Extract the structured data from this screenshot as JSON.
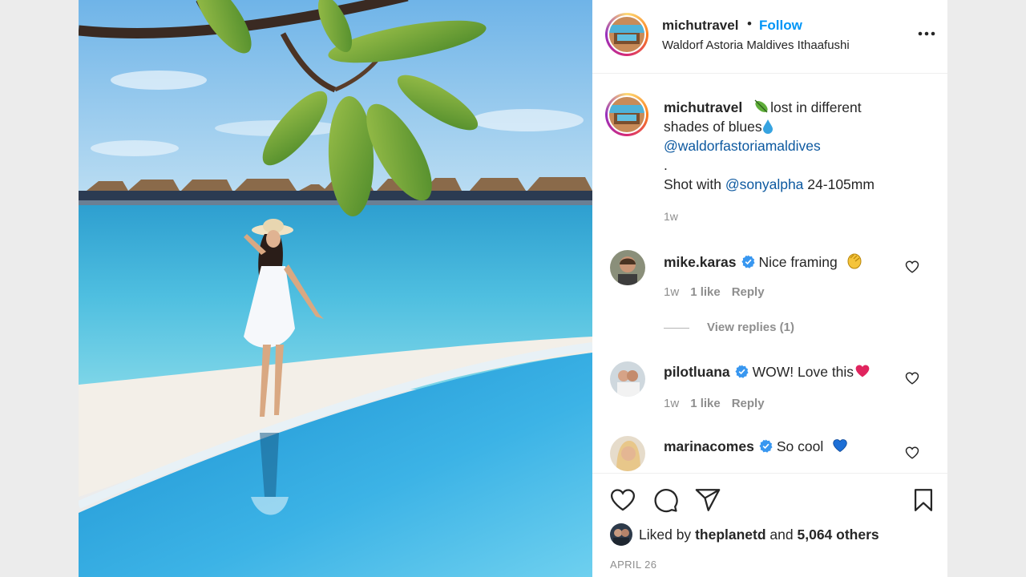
{
  "post": {
    "username": "michutravel",
    "separator": "•",
    "follow_label": "Follow",
    "location": "Waldorf Astoria Maldives Ithaafushi"
  },
  "caption": {
    "username": "michutravel",
    "text_1": "lost in different",
    "text_2": "shades of blues",
    "mention_1": "@waldorfastoriamaldives",
    "dot": ".",
    "shot_with": "Shot with",
    "mention_2": "@sonyalpha",
    "lens": "24-105mm",
    "time": "1w"
  },
  "comments": [
    {
      "username": "mike.karas",
      "text": "Nice framing",
      "time": "1w",
      "likes": "1 like",
      "reply": "Reply",
      "emoji": "clap-emoji"
    },
    {
      "username": "pilotluana",
      "text": "WOW! Love this",
      "time": "1w",
      "likes": "1 like",
      "reply": "Reply",
      "emoji": "red-heart-emoji"
    },
    {
      "username": "marinacomes",
      "text": "So cool",
      "emoji": "blue-heart-emoji"
    }
  ],
  "view_replies": "View replies (1)",
  "likes": {
    "prefix": "Liked by",
    "user": "theplanetd",
    "and": "and",
    "count": "5,064 others"
  },
  "date": "APRIL 26",
  "colors": {
    "accent": "#0095f6",
    "verified": "#3897f0",
    "meta_gray": "#8e8e8e"
  },
  "icons": [
    "heart-icon",
    "comment-icon",
    "share-icon",
    "bookmark-icon",
    "more-options-icon",
    "verified-badge-icon"
  ]
}
